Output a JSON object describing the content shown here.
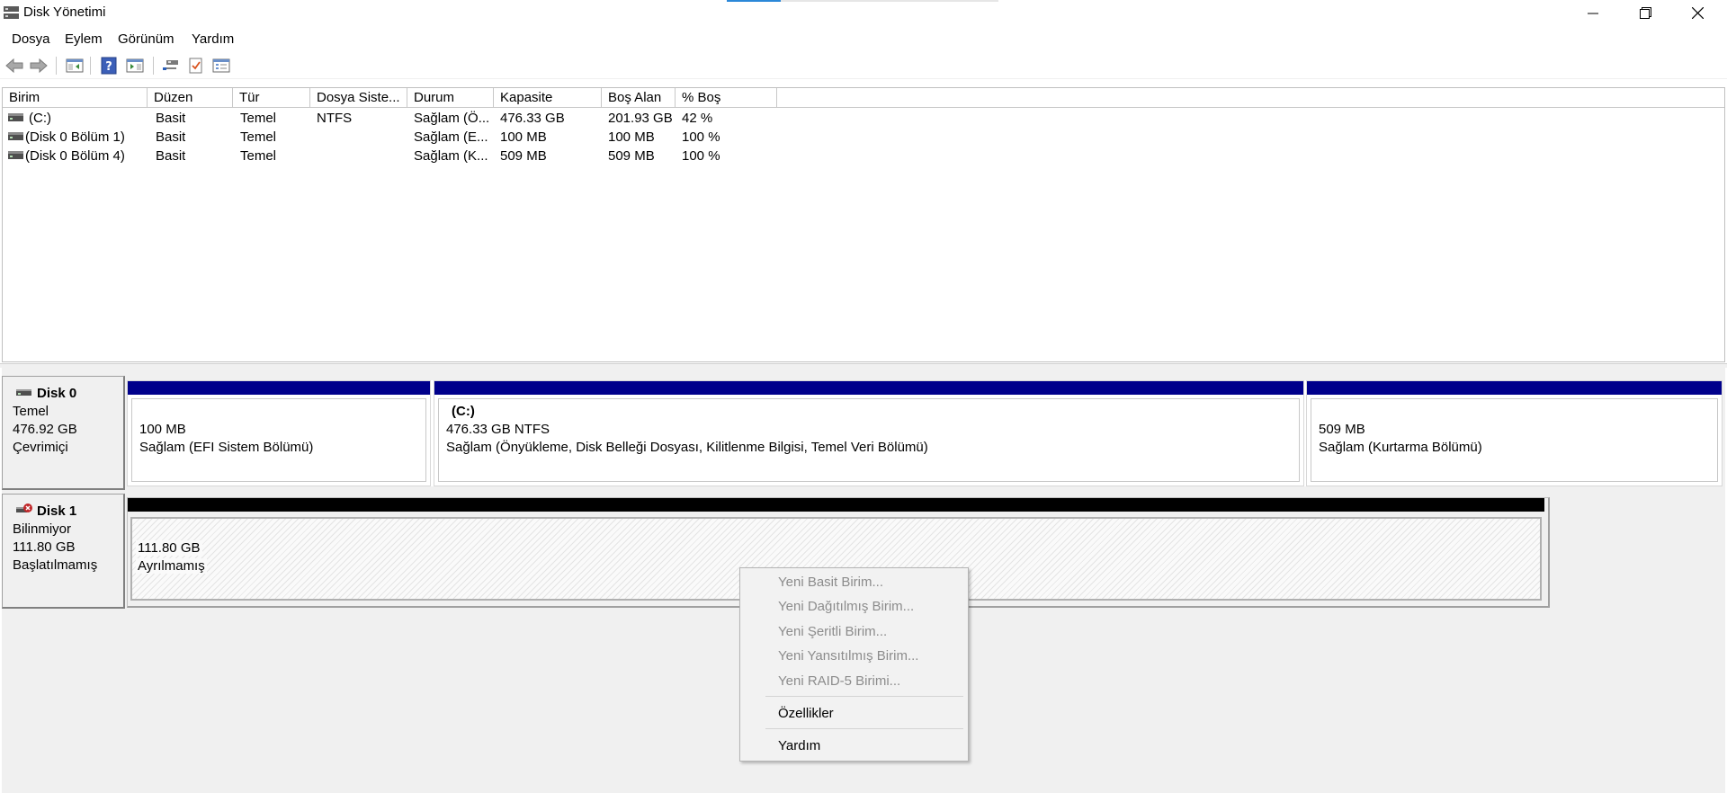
{
  "window": {
    "title": "Disk Yönetimi",
    "controls": {
      "minimize": "minimize-icon",
      "maximize": "restore-icon",
      "close": "close-icon"
    }
  },
  "menu": {
    "items": [
      "Dosya",
      "Eylem",
      "Görünüm",
      "Yardım"
    ]
  },
  "toolbar": {
    "buttons": [
      "back-arrow-icon",
      "forward-arrow-icon",
      "console-tree-icon",
      "help-icon",
      "action-pane-icon",
      "disk-connect-icon",
      "checklist-icon",
      "properties-list-icon"
    ]
  },
  "volume_list": {
    "columns": [
      "Birim",
      "Düzen",
      "Tür",
      "Dosya Siste...",
      "Durum",
      "Kapasite",
      "Boş Alan",
      "% Boş"
    ],
    "rows": [
      {
        "birim": "(C:)",
        "duzen": "Basit",
        "tur": "Temel",
        "dosya_sistemi": "NTFS",
        "durum": "Sağlam (Ö...",
        "kapasite": "476.33 GB",
        "bos_alan": "201.93 GB",
        "yuzde_bos": "42 %"
      },
      {
        "birim": "(Disk 0 Bölüm 1)",
        "duzen": "Basit",
        "tur": "Temel",
        "dosya_sistemi": "",
        "durum": "Sağlam (E...",
        "kapasite": "100 MB",
        "bos_alan": "100 MB",
        "yuzde_bos": "100 %"
      },
      {
        "birim": "(Disk 0 Bölüm 4)",
        "duzen": "Basit",
        "tur": "Temel",
        "dosya_sistemi": "",
        "durum": "Sağlam (K...",
        "kapasite": "509 MB",
        "bos_alan": "509 MB",
        "yuzde_bos": "100 %"
      }
    ]
  },
  "disks": [
    {
      "name": "Disk 0",
      "type": "Temel",
      "size": "476.92 GB",
      "status": "Çevrimiçi",
      "partitions": [
        {
          "label": "",
          "size": "100 MB",
          "status": "Sağlam (EFI Sistem Bölümü)"
        },
        {
          "label": "(C:)",
          "size": "476.33 GB NTFS",
          "status": "Sağlam (Önyükleme, Disk Belleği Dosyası, Kilitlenme Bilgisi, Temel Veri Bölümü)"
        },
        {
          "label": "",
          "size": "509 MB",
          "status": "Sağlam (Kurtarma Bölümü)"
        }
      ]
    },
    {
      "name": "Disk 1",
      "type": "Bilinmiyor",
      "size": "111.80 GB",
      "status": "Başlatılmamış",
      "partitions": [
        {
          "size": "111.80 GB",
          "status": "Ayrılmamış"
        }
      ]
    }
  ],
  "context_menu": {
    "items": [
      {
        "label": "Yeni Basit Birim...",
        "enabled": false
      },
      {
        "label": "Yeni Dağıtılmış Birim...",
        "enabled": false
      },
      {
        "label": "Yeni Şeritli Birim...",
        "enabled": false
      },
      {
        "label": "Yeni Yansıtılmış Birim...",
        "enabled": false
      },
      {
        "label": "Yeni RAID-5 Birimi...",
        "enabled": false
      },
      {
        "label": "Özellikler",
        "enabled": true
      },
      {
        "label": "Yardım",
        "enabled": true
      }
    ]
  },
  "colors": {
    "partition_bar": "#00008b",
    "unallocated_bar": "#000000",
    "disabled_text": "#8c8c8c"
  }
}
